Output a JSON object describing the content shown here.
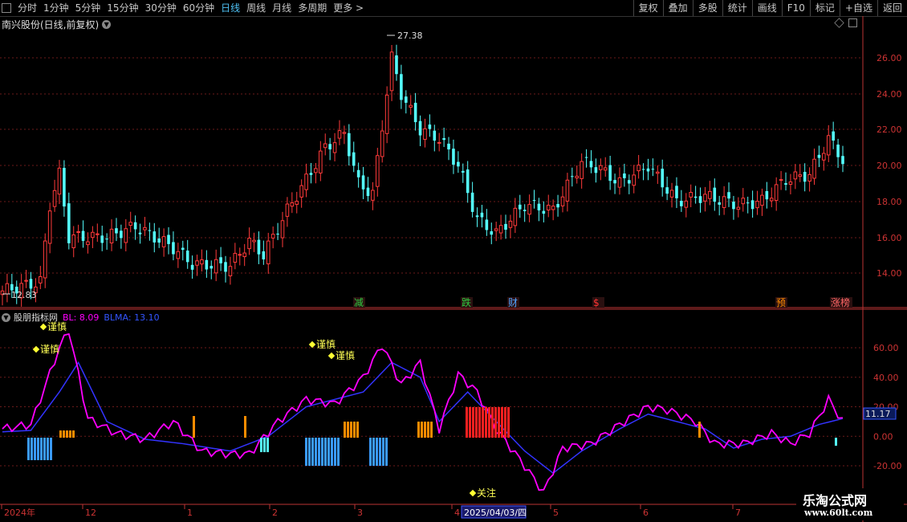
{
  "toolbar": {
    "periods": [
      "分时",
      "1分钟",
      "5分钟",
      "15分钟",
      "30分钟",
      "60分钟",
      "日线",
      "周线",
      "月线",
      "多周期",
      "更多 >"
    ],
    "active_period": "日线",
    "right_buttons": [
      "复权",
      "叠加",
      "多股",
      "统计",
      "画线",
      "F10",
      "标记",
      "+自选",
      "返回"
    ]
  },
  "header": {
    "title": "南兴股份(日线,前复权)"
  },
  "main_chart": {
    "y_ticks": [
      "26.00",
      "24.00",
      "22.00",
      "20.00",
      "18.00",
      "16.00",
      "14.00"
    ],
    "high_label": "27.38",
    "low_label": "12.83",
    "event_tags": [
      {
        "text": "减",
        "color": "#2ecc40"
      },
      {
        "text": "跌",
        "color": "#2ecc40"
      },
      {
        "text": "财",
        "color": "#4fa3ff"
      },
      {
        "text": "$",
        "color": "#ff3333"
      },
      {
        "text": "预",
        "color": "#ff8c00"
      },
      {
        "text": "涨榜",
        "color": "#ff6666"
      }
    ]
  },
  "indicator": {
    "name": "股朋指标网",
    "bl_label": "BL: 8.09",
    "blma_label": "BLMA: 13.10",
    "y_ticks": [
      "60.00",
      "40.00",
      "20.00",
      "0.00",
      "-20.00"
    ],
    "current_value": "11.17",
    "annotations": [
      "谨慎",
      "谨慎",
      "谨慎",
      "谨慎",
      "关注"
    ],
    "colors": {
      "bl": "#ff00ff",
      "blma": "#3333ff"
    }
  },
  "x_axis": {
    "labels": [
      "2024年",
      "12",
      "1",
      "2",
      "3",
      "4",
      "5",
      "6",
      "7"
    ],
    "cursor_date": "2025/04/03/四"
  },
  "watermark": {
    "line1": "乐淘公式网",
    "line2": "www.60lt.com"
  }
}
